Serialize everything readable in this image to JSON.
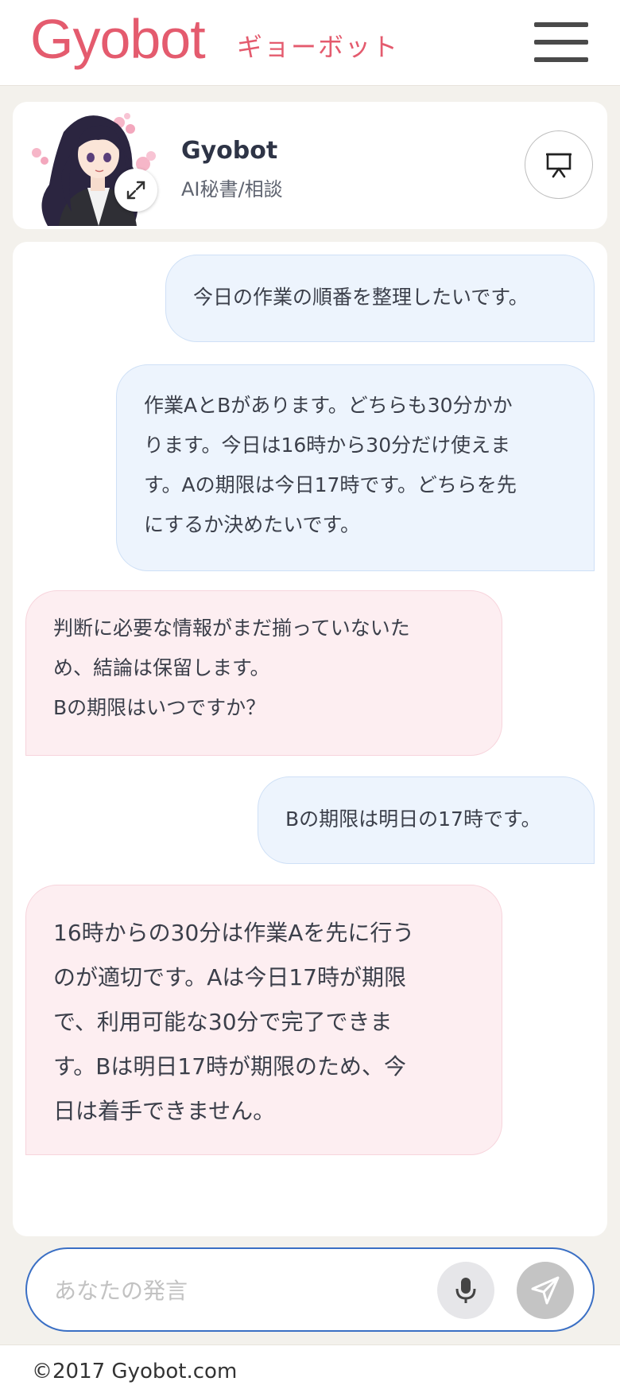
{
  "header": {
    "logo": "Gyobot",
    "logo_sub": "ギョーボット",
    "menu_icon": "hamburger-menu-icon"
  },
  "profile": {
    "name": "Gyobot",
    "role": "AI秘書/相談",
    "expand_icon": "expand-icon",
    "present_icon": "presentation-icon"
  },
  "messages": [
    {
      "sender": "user",
      "lines": [
        "今日の作業の順番を整理したいです。"
      ]
    },
    {
      "sender": "user",
      "lines": [
        "作業AとBがあります。どちらも30分かか",
        "ります。今日は16時から30分だけ使えま",
        "す。Aの期限は今日17時です。どちらを先",
        "にするか決めたいです。"
      ]
    },
    {
      "sender": "bot",
      "lines": [
        "判断に必要な情報がまだ揃っていないた",
        "め、結論は保留します。",
        "Bの期限はいつですか？"
      ]
    },
    {
      "sender": "user",
      "lines": [
        "Bの期限は明日の17時です。"
      ]
    },
    {
      "sender": "bot",
      "lines": [
        "16時からの30分は作業Aを先に行う",
        "のが適切です。Aは今日17時が期限",
        "で、利用可能な30分で完了できま",
        "す。Bは明日17時が期限のため、今",
        "日は着手できません。"
      ]
    }
  ],
  "input": {
    "placeholder": "あなたの発言",
    "value": ""
  },
  "footer": {
    "copyright": "©2017 Gyobot.com"
  },
  "colors": {
    "brand": "#e45b6e",
    "user_bubble": "#edf4fd",
    "bot_bubble": "#fdeef1",
    "input_border": "#3a6fc4"
  }
}
